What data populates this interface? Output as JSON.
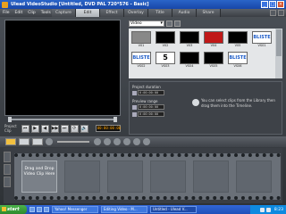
{
  "window": {
    "title": "Ulead VideoStudio [Untitled, DVD PAL 720*576 - Basic]"
  },
  "menu": {
    "items": [
      "File",
      "Edit",
      "Clip",
      "Tools"
    ]
  },
  "steps": {
    "items": [
      "Capture",
      "Edit",
      "Effect",
      "Overlay",
      "Title",
      "Audio",
      "Share"
    ],
    "active": "Edit"
  },
  "preview": {
    "mode_labels": [
      "Project",
      "Clip"
    ],
    "timecode": "00:00:00:00",
    "buttons": [
      "⏮",
      "▶",
      "◀",
      "▶▶",
      "⏭",
      "⟳",
      "🔊"
    ]
  },
  "library": {
    "category": "Video",
    "clips": [
      {
        "caption": "V01",
        "style": "grey",
        "label": ""
      },
      {
        "caption": "V02",
        "style": "black",
        "label": ""
      },
      {
        "caption": "V03",
        "style": "black",
        "label": ""
      },
      {
        "caption": "V04",
        "style": "red",
        "label": ""
      },
      {
        "caption": "V05",
        "style": "black",
        "label": ""
      },
      {
        "caption": "VS01",
        "style": "blue",
        "label": "BLISTE"
      },
      {
        "caption": "VS02",
        "style": "blue",
        "label": "BLISTE"
      },
      {
        "caption": "VS03",
        "style": "five",
        "label": "5"
      },
      {
        "caption": "VS04",
        "style": "black",
        "label": ""
      },
      {
        "caption": "VS05",
        "style": "black",
        "label": ""
      },
      {
        "caption": "VS06",
        "style": "blue",
        "label": "BLISTE"
      }
    ]
  },
  "options": {
    "project_duration_label": "Project duration",
    "project_duration": "0:00:00:00",
    "preview_range_label": "Preview range",
    "preview_start": "0:00:00:00",
    "preview_end": "0:00:00:00",
    "hint": "You can select clips from the Library then drag them into the Timeline."
  },
  "timeline": {
    "dropzone_text": "Drag and Drop Video Clip Here"
  },
  "taskbar": {
    "start": "start",
    "tasks": [
      "Yahoo! Messenger",
      "Editing Video - M...",
      "Untitled - Ulead V..."
    ],
    "active_task": 2,
    "clock": "8:23"
  }
}
